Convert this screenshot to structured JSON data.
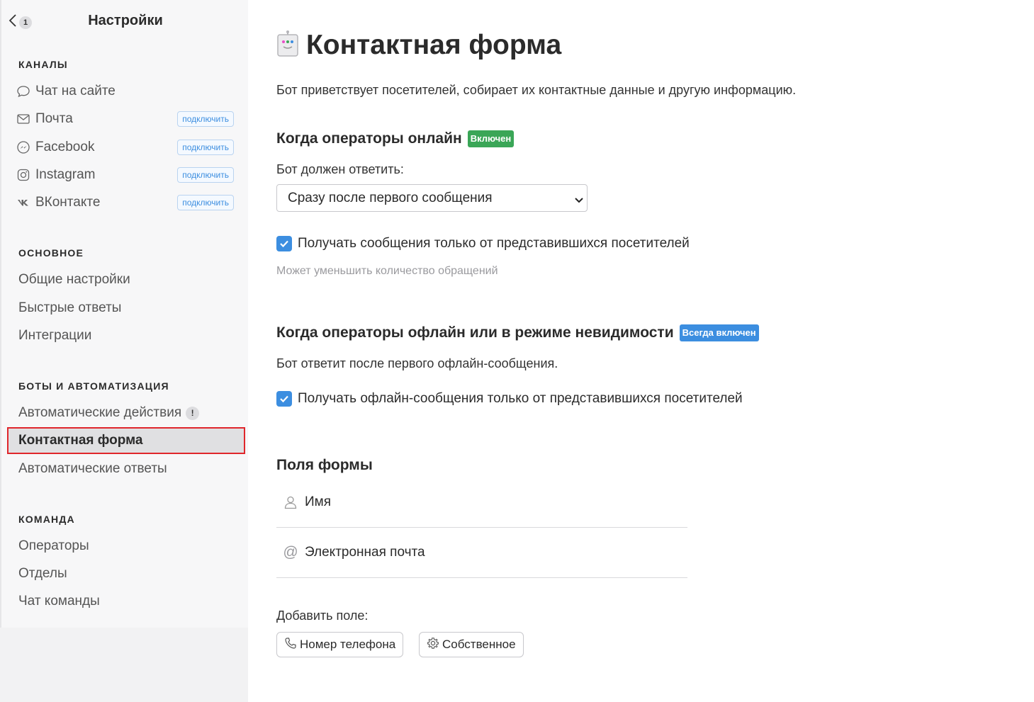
{
  "sidebar": {
    "back_count": "1",
    "title": "Настройки",
    "sections": {
      "channels": {
        "title": "КАНАЛЫ",
        "items": [
          {
            "label": "Чат на сайте",
            "icon": "chat-bubble-icon"
          },
          {
            "label": "Почта",
            "icon": "mail-icon",
            "action": "подключить"
          },
          {
            "label": "Facebook",
            "icon": "messenger-icon",
            "action": "подключить"
          },
          {
            "label": "Instagram",
            "icon": "instagram-icon",
            "action": "подключить"
          },
          {
            "label": "ВКонтакте",
            "icon": "vk-icon",
            "action": "подключить"
          }
        ]
      },
      "main": {
        "title": "ОСНОВНОЕ",
        "items": [
          {
            "label": "Общие настройки"
          },
          {
            "label": "Быстрые ответы"
          },
          {
            "label": "Интеграции"
          }
        ]
      },
      "bots": {
        "title": "БОТЫ И АВТОМАТИЗАЦИЯ",
        "items": [
          {
            "label": "Автоматические действия",
            "badge": "!"
          },
          {
            "label": "Контактная форма",
            "active": true
          },
          {
            "label": "Автоматические ответы"
          }
        ]
      },
      "team": {
        "title": "КОМАНДА",
        "items": [
          {
            "label": "Операторы"
          },
          {
            "label": "Отделы"
          },
          {
            "label": "Чат команды"
          }
        ]
      }
    }
  },
  "main": {
    "title": "Контактная форма",
    "description": "Бот приветствует посетителей, собирает их контактные данные и другую информацию.",
    "online": {
      "heading": "Когда операторы онлайн",
      "badge": "Включен",
      "reply_label": "Бот должен ответить:",
      "reply_select": "Сразу после первого сообщения",
      "checkbox_label": "Получать сообщения только от представившихся посетителей",
      "checkbox_checked": true,
      "hint": "Может уменьшить количество обращений"
    },
    "offline": {
      "heading": "Когда операторы офлайн или в режиме невидимости",
      "badge": "Всегда включен",
      "note": "Бот ответит после первого офлайн-сообщения.",
      "checkbox_label": "Получать офлайн-сообщения только от представившихся посетителей",
      "checkbox_checked": true
    },
    "fields": {
      "heading": "Поля формы",
      "items": [
        {
          "label": "Имя",
          "icon": "user-icon"
        },
        {
          "label": "Электронная почта",
          "icon": "at-icon"
        }
      ],
      "add_label": "Добавить поле:",
      "add_buttons": [
        {
          "label": "Номер телефона",
          "icon": "phone-icon"
        },
        {
          "label": "Собственное",
          "icon": "gear-icon"
        }
      ]
    }
  },
  "colors": {
    "accent": "#3c8ee0",
    "success": "#3aa657",
    "highlight_border": "#e0262b"
  }
}
